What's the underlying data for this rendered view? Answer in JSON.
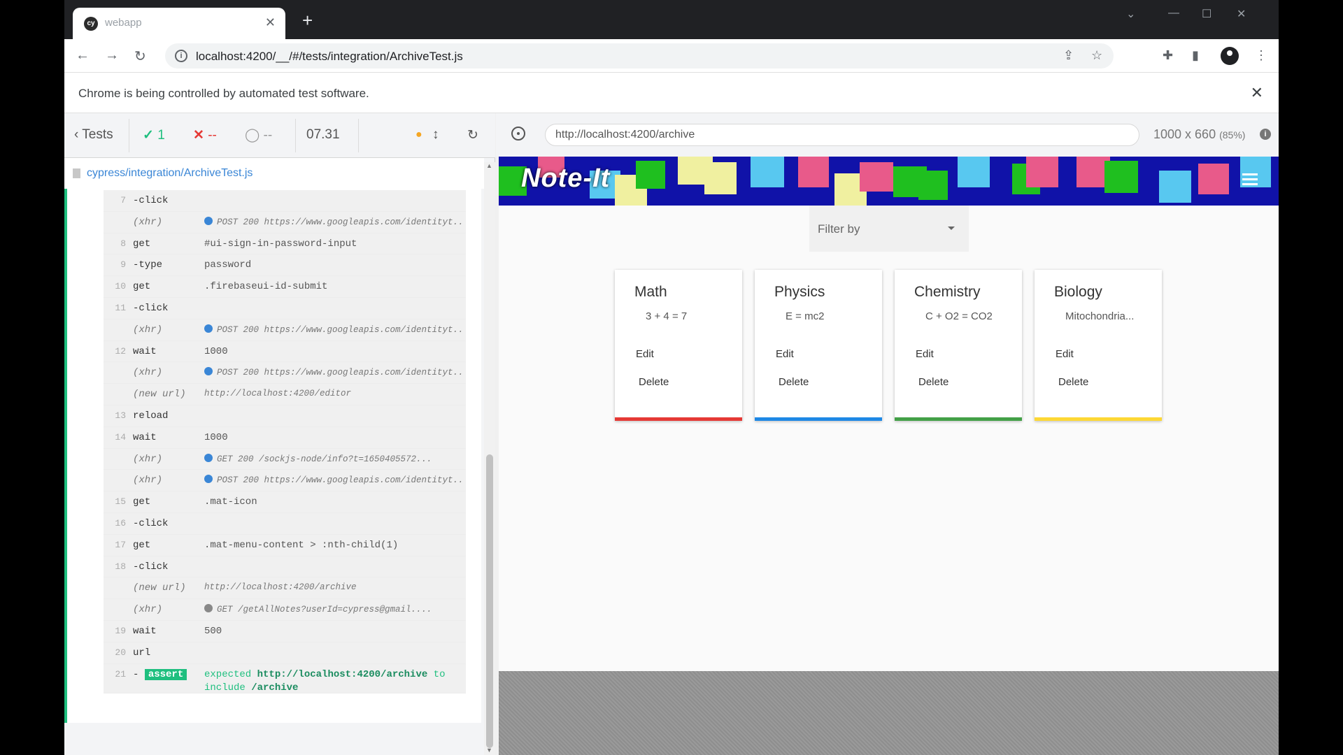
{
  "browser": {
    "tab_title": "webapp",
    "url": "localhost:4200/__/#/tests/integration/ArchiveTest.js",
    "infobar_message": "Chrome is being controlled by automated test software."
  },
  "reporter": {
    "back_label": "Tests",
    "passed": "1",
    "failed": "--",
    "pending": "--",
    "duration": "07.31",
    "spec_path": "cypress/integration/ArchiveTest.js",
    "commands": [
      {
        "num": "7",
        "name": "-click",
        "message": ""
      },
      {
        "num": "",
        "name": "(xhr)",
        "message": "POST 200 https://www.googleapis.com/identityt...",
        "dot": "blue"
      },
      {
        "num": "8",
        "name": "get",
        "message": "#ui-sign-in-password-input"
      },
      {
        "num": "9",
        "name": "-type",
        "message": "password"
      },
      {
        "num": "10",
        "name": "get",
        "message": ".firebaseui-id-submit"
      },
      {
        "num": "11",
        "name": "-click",
        "message": ""
      },
      {
        "num": "",
        "name": "(xhr)",
        "message": "POST 200 https://www.googleapis.com/identityt...",
        "dot": "blue"
      },
      {
        "num": "12",
        "name": "wait",
        "message": "1000"
      },
      {
        "num": "",
        "name": "(xhr)",
        "message": "POST 200 https://www.googleapis.com/identityt...",
        "dot": "blue"
      },
      {
        "num": "",
        "name": "(new url)",
        "message": "http://localhost:4200/editor"
      },
      {
        "num": "13",
        "name": "reload",
        "message": ""
      },
      {
        "num": "14",
        "name": "wait",
        "message": "1000"
      },
      {
        "num": "",
        "name": "(xhr)",
        "message": "GET 200 /sockjs-node/info?t=1650405572...",
        "dot": "blue"
      },
      {
        "num": "",
        "name": "(xhr)",
        "message": "POST 200 https://www.googleapis.com/identityt...",
        "dot": "blue"
      },
      {
        "num": "15",
        "name": "get",
        "message": ".mat-icon"
      },
      {
        "num": "16",
        "name": "-click",
        "message": ""
      },
      {
        "num": "17",
        "name": "get",
        "message": ".mat-menu-content > :nth-child(1)"
      },
      {
        "num": "18",
        "name": "-click",
        "message": ""
      },
      {
        "num": "",
        "name": "(new url)",
        "message": "http://localhost:4200/archive"
      },
      {
        "num": "",
        "name": "(xhr)",
        "message": "GET /getAllNotes?userId=cypress@gmail....",
        "dot": "grey"
      },
      {
        "num": "19",
        "name": "wait",
        "message": "500"
      },
      {
        "num": "20",
        "name": "url",
        "message": ""
      }
    ],
    "assert": {
      "num": "21",
      "badge": "assert",
      "word_expected": "expected",
      "value": "http://localhost:4200/archive",
      "word_to": "to",
      "word_include": "include",
      "target": "/archive"
    }
  },
  "aut": {
    "url": "http://localhost:4200/archive",
    "size": "1000 x 660",
    "scale": "(85%)"
  },
  "app": {
    "logo": "Note-It",
    "filter_placeholder": "Filter by",
    "cards": [
      {
        "title": "Math",
        "body": "3 + 4 = 7",
        "edit": "Edit",
        "delete": "Delete",
        "color": "#e53935"
      },
      {
        "title": "Physics",
        "body": "E = mc2",
        "edit": "Edit",
        "delete": "Delete",
        "color": "#1e88e5"
      },
      {
        "title": "Chemistry",
        "body": "C + O2 = CO2",
        "edit": "Edit",
        "delete": "Delete",
        "color": "#43a047"
      },
      {
        "title": "Biology",
        "body": "Mitochondria...",
        "edit": "Edit",
        "delete": "Delete",
        "color": "#fdd835"
      }
    ]
  },
  "colors": {
    "pass": "#1fbf7f",
    "fail": "#e53935",
    "link": "#3a86d6",
    "appbar": "#1012a8"
  }
}
